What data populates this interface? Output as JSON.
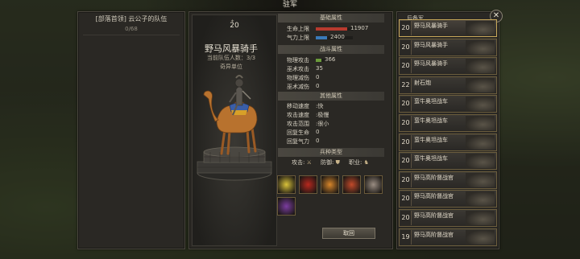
{
  "screen_title": "驻军",
  "left_panel": {
    "title": "[部落首领] 云公子的队伍",
    "count": "0/68"
  },
  "unit": {
    "level": "20",
    "name": "野马风暴骑手",
    "squad_count": "当前队伍人数：3/3",
    "note": "奇异单位"
  },
  "sections": {
    "basic": "基础属性",
    "combat": "战斗属性",
    "other": "其他属性",
    "type": "兵种类型"
  },
  "basic_stats": [
    {
      "label": "生命上限",
      "value": "11907",
      "bar_color": "#b83a2e",
      "fill": 0.85
    },
    {
      "label": "气力上限",
      "value": "2400",
      "bar_color": "#3a7ab8",
      "fill": 0.3
    }
  ],
  "combat_stats": [
    {
      "label": "物理攻击",
      "value": "366",
      "bar_color": "#6a9a3a",
      "fill": 0.35
    },
    {
      "label": "巫术攻击",
      "value": "35"
    },
    {
      "label": "物理减伤",
      "value": "0"
    },
    {
      "label": "巫术减伤",
      "value": "0"
    }
  ],
  "other_stats": [
    {
      "label": "移动速度",
      "value": ":快"
    },
    {
      "label": "攻击速度",
      "value": ":极慢"
    },
    {
      "label": "攻击范围",
      "value": ":很小"
    },
    {
      "label": "回复生命",
      "value": "0"
    },
    {
      "label": "回复气力",
      "value": "0"
    }
  ],
  "type_row": {
    "attack_label": "攻击:",
    "defense_label": "防御:",
    "class_label": "职业:"
  },
  "skills": [
    {
      "icon": "crescent-slash-icon",
      "color": "#d9c23a"
    },
    {
      "icon": "demon-mask-icon",
      "color": "#b8281e"
    },
    {
      "icon": "fire-burst-icon",
      "color": "#d8862a"
    },
    {
      "icon": "vortex-icon",
      "color": "#c24a2a"
    },
    {
      "icon": "beast-head-icon",
      "color": "#9a8d82"
    },
    {
      "icon": "ram-horn-icon",
      "color": "#7b3ca0"
    }
  ],
  "close_button": "取回",
  "reserve": {
    "title": "后备军",
    "items": [
      {
        "level": "20",
        "name": "野马风暴骑手",
        "selected": true
      },
      {
        "level": "20",
        "name": "野马风暴骑手"
      },
      {
        "level": "20",
        "name": "野马风暴骑手"
      },
      {
        "level": "22",
        "name": "射石炮"
      },
      {
        "level": "20",
        "name": "蛮牛奥坦战车"
      },
      {
        "level": "20",
        "name": "蛮牛奥坦战车"
      },
      {
        "level": "20",
        "name": "蛮牛奥坦战车"
      },
      {
        "level": "20",
        "name": "蛮牛奥坦战车"
      },
      {
        "level": "20",
        "name": "野马高阶督战官"
      },
      {
        "level": "20",
        "name": "野马高阶督战官"
      },
      {
        "level": "20",
        "name": "野马高阶督战官"
      },
      {
        "level": "19",
        "name": "野马高阶督战官"
      }
    ]
  }
}
